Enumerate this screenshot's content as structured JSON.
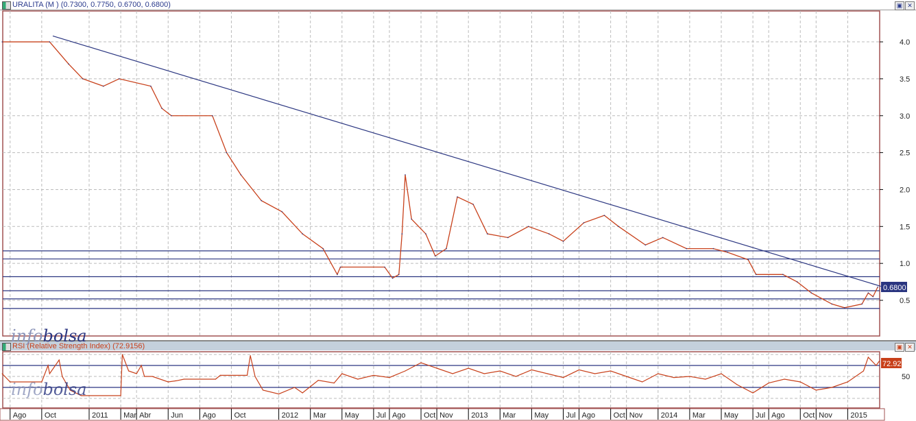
{
  "header": {
    "title": "URALITA (M ) (0.7300, 0.7750, 0.6700, 0.6800)",
    "restore": "▣",
    "close": "✕"
  },
  "rsi_header": {
    "title": "RSI (Relative Strength Index) (72.9156)"
  },
  "watermark": {
    "a": "info",
    "b": "bolsa"
  },
  "colors": {
    "price": "#c8401a",
    "trend": "#2a3580",
    "grid": "#bbbbbb",
    "frame": "#a05050",
    "last_badge": "#2a3580",
    "rsi_badge": "#c8401a"
  },
  "chart_data": [
    {
      "type": "line",
      "title": "URALITA (M )",
      "ylim": [
        0.1,
        4.5
      ],
      "yticks": [
        "0.5",
        "1.0",
        "1.5",
        "2.0",
        "2.5",
        "3.0",
        "3.5",
        "4.0"
      ],
      "ytick_values": [
        0.5,
        1,
        1.5,
        2,
        2.5,
        3,
        3.5,
        4
      ],
      "x_unit": "months since Jan 2011",
      "series": [
        {
          "name": "price",
          "points": [
            [
              -5.5,
              4.0
            ],
            [
              -2.5,
              4.0
            ],
            [
              -1.3,
              3.7
            ],
            [
              -0.4,
              3.5
            ],
            [
              0.9,
              3.4
            ],
            [
              1.9,
              3.5
            ],
            [
              3.9,
              3.4
            ],
            [
              4.6,
              3.1
            ],
            [
              5.2,
              3.0
            ],
            [
              7.8,
              3.0
            ],
            [
              8.7,
              2.5
            ],
            [
              9.6,
              2.2
            ],
            [
              10.9,
              1.85
            ],
            [
              12.2,
              1.7
            ],
            [
              13.5,
              1.4
            ],
            [
              14.8,
              1.2
            ],
            [
              15.7,
              0.85
            ],
            [
              15.9,
              0.95
            ],
            [
              18.7,
              0.95
            ],
            [
              19.2,
              0.8
            ],
            [
              19.6,
              0.85
            ],
            [
              19.8,
              1.4
            ],
            [
              20.0,
              2.2
            ],
            [
              20.4,
              1.6
            ],
            [
              21.3,
              1.4
            ],
            [
              21.9,
              1.1
            ],
            [
              22.6,
              1.2
            ],
            [
              23.3,
              1.9
            ],
            [
              24.3,
              1.8
            ],
            [
              25.2,
              1.4
            ],
            [
              26.5,
              1.35
            ],
            [
              27.8,
              1.5
            ],
            [
              29.1,
              1.4
            ],
            [
              30.0,
              1.3
            ],
            [
              31.3,
              1.55
            ],
            [
              32.6,
              1.65
            ],
            [
              33.5,
              1.5
            ],
            [
              35.2,
              1.25
            ],
            [
              36.3,
              1.35
            ],
            [
              37.8,
              1.2
            ],
            [
              39.5,
              1.2
            ],
            [
              40.4,
              1.15
            ],
            [
              41.7,
              1.05
            ],
            [
              42.2,
              0.85
            ],
            [
              43.9,
              0.85
            ],
            [
              44.8,
              0.75
            ],
            [
              45.7,
              0.6
            ],
            [
              47.0,
              0.45
            ],
            [
              47.8,
              0.4
            ],
            [
              48.9,
              0.45
            ],
            [
              49.3,
              0.6
            ],
            [
              49.6,
              0.55
            ],
            [
              49.9,
              0.68
            ]
          ]
        }
      ],
      "trendline": [
        [
          -2.3,
          4.08
        ],
        [
          50.1,
          0.69
        ]
      ],
      "hlines": [
        1.17,
        1.06,
        0.82,
        0.63,
        0.52,
        0.39
      ],
      "last_value": "0.6800"
    },
    {
      "type": "line",
      "title": "RSI (Relative Strength Index)",
      "ylim": [
        0,
        100
      ],
      "yticks": [
        "50"
      ],
      "ytick_values": [
        50
      ],
      "hlines": [
        70,
        30
      ],
      "series": [
        {
          "name": "RSI",
          "points": [
            [
              -5.5,
              55
            ],
            [
              -5,
              40
            ],
            [
              -3,
              40
            ],
            [
              -2.6,
              70
            ],
            [
              -2.5,
              55
            ],
            [
              -1.9,
              80
            ],
            [
              -1.7,
              50
            ],
            [
              -1.2,
              25
            ],
            [
              -0.5,
              15
            ],
            [
              2,
              15
            ],
            [
              2.1,
              90
            ],
            [
              2.5,
              60
            ],
            [
              3,
              55
            ],
            [
              3.3,
              70
            ],
            [
              3.5,
              50
            ],
            [
              4,
              50
            ],
            [
              5,
              40
            ],
            [
              5.5,
              42
            ],
            [
              6,
              45
            ],
            [
              8,
              45
            ],
            [
              8.3,
              52
            ],
            [
              10,
              52
            ],
            [
              10.2,
              88
            ],
            [
              10.5,
              50
            ],
            [
              11,
              25
            ],
            [
              12,
              18
            ],
            [
              13,
              30
            ],
            [
              13.5,
              20
            ],
            [
              14.5,
              43
            ],
            [
              15.5,
              38
            ],
            [
              16,
              55
            ],
            [
              17,
              45
            ],
            [
              18,
              52
            ],
            [
              19,
              48
            ],
            [
              20,
              60
            ],
            [
              21,
              75
            ],
            [
              22,
              65
            ],
            [
              23,
              55
            ],
            [
              24,
              65
            ],
            [
              25,
              55
            ],
            [
              26,
              60
            ],
            [
              27,
              50
            ],
            [
              28,
              62
            ],
            [
              29,
              55
            ],
            [
              30,
              48
            ],
            [
              31,
              62
            ],
            [
              32,
              55
            ],
            [
              33,
              60
            ],
            [
              34,
              50
            ],
            [
              35,
              40
            ],
            [
              36,
              55
            ],
            [
              37,
              48
            ],
            [
              38,
              50
            ],
            [
              39,
              45
            ],
            [
              40,
              55
            ],
            [
              41,
              35
            ],
            [
              42,
              20
            ],
            [
              43,
              38
            ],
            [
              44,
              45
            ],
            [
              45,
              40
            ],
            [
              46,
              25
            ],
            [
              47,
              30
            ],
            [
              48,
              40
            ],
            [
              49,
              60
            ],
            [
              49.3,
              85
            ],
            [
              49.8,
              70
            ],
            [
              50,
              78
            ]
          ]
        }
      ],
      "last_value": "72.92"
    },
    {
      "type": "axis",
      "xticks": [
        {
          "label": "Ago",
          "t": -5
        },
        {
          "label": "Oct",
          "t": -3
        },
        {
          "label": "2011",
          "t": 0
        },
        {
          "label": "Mar",
          "t": 2
        },
        {
          "label": "Abr",
          "t": 3
        },
        {
          "label": "Jun",
          "t": 5
        },
        {
          "label": "Ago",
          "t": 7
        },
        {
          "label": "Oct",
          "t": 9
        },
        {
          "label": "2012",
          "t": 12
        },
        {
          "label": "Mar",
          "t": 14
        },
        {
          "label": "May",
          "t": 16
        },
        {
          "label": "Jul",
          "t": 18
        },
        {
          "label": "Ago",
          "t": 19
        },
        {
          "label": "Oct",
          "t": 21
        },
        {
          "label": "Nov",
          "t": 22
        },
        {
          "label": "2013",
          "t": 24
        },
        {
          "label": "Mar",
          "t": 26
        },
        {
          "label": "May",
          "t": 28
        },
        {
          "label": "Jul",
          "t": 30
        },
        {
          "label": "Ago",
          "t": 31
        },
        {
          "label": "Oct",
          "t": 33
        },
        {
          "label": "Nov",
          "t": 34
        },
        {
          "label": "2014",
          "t": 36
        },
        {
          "label": "Mar",
          "t": 38
        },
        {
          "label": "May",
          "t": 40
        },
        {
          "label": "Jul",
          "t": 42
        },
        {
          "label": "Ago",
          "t": 43
        },
        {
          "label": "Oct",
          "t": 45
        },
        {
          "label": "Nov",
          "t": 46
        },
        {
          "label": "2015",
          "t": 48
        }
      ]
    }
  ]
}
